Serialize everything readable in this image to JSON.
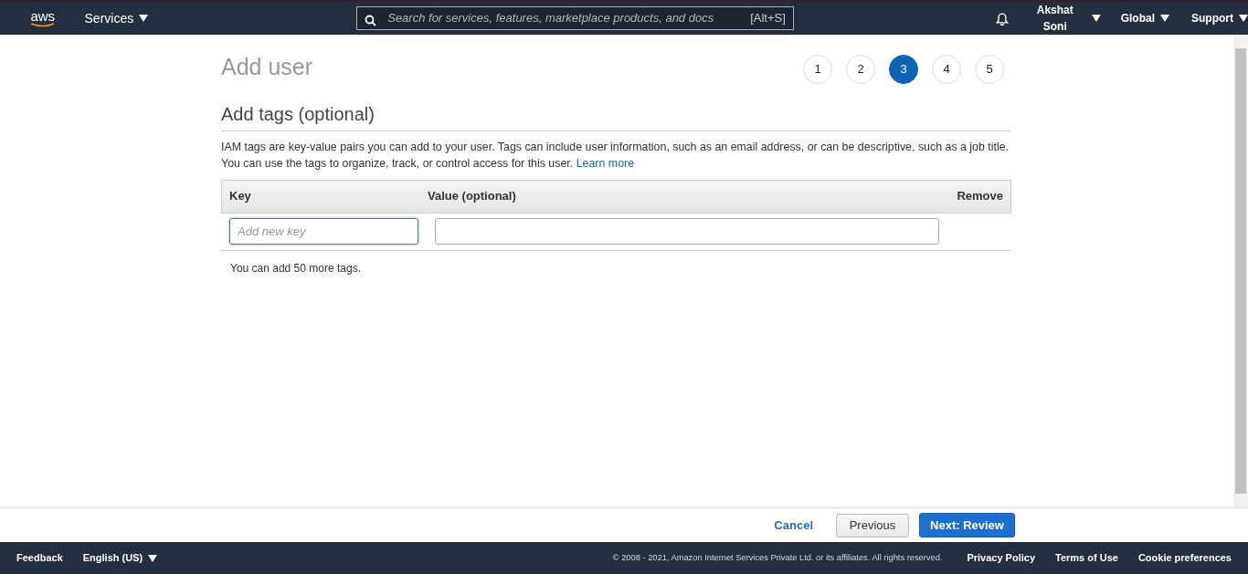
{
  "navbar": {
    "logo": "aws",
    "services": "Services",
    "search": {
      "placeholder": "Search for services, features, marketplace products, and docs",
      "shortcut": "[Alt+S]"
    },
    "user": "Akshat Soni",
    "region": "Global",
    "support": "Support"
  },
  "page": {
    "title": "Add user",
    "steps": [
      {
        "label": "1",
        "selected": false
      },
      {
        "label": "2",
        "selected": false
      },
      {
        "label": "3",
        "selected": true
      },
      {
        "label": "4",
        "selected": false
      },
      {
        "label": "5",
        "selected": false
      }
    ]
  },
  "section": {
    "title": "Add tags (optional)",
    "description": "IAM tags are key-value pairs you can add to your user. Tags can include user information, such as an email address, or can be descriptive, such as a job title. You can use the tags to organize, track, or control access for this user.",
    "link": "Learn more"
  },
  "table": {
    "columns": [
      "Key",
      "Value (optional)",
      "Remove"
    ],
    "rows": [
      {
        "key_placeholder": "Add new key"
      }
    ],
    "note": "You can add 50 more tags."
  },
  "actions": {
    "cancel": "Cancel",
    "previous": "Previous",
    "next": "Next: Review"
  },
  "footer": {
    "feedback": "Feedback",
    "language": "English (US)",
    "copyright": "© 2008 - 2021, Amazon Internet Services Private Ltd. or its affiliates. All rights reserved.",
    "links": [
      "Privacy Policy",
      "Terms of Use",
      "Cookie preferences"
    ]
  }
}
